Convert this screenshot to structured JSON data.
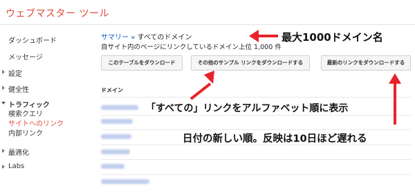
{
  "header": {
    "title": "ウェブマスター ツール"
  },
  "sidebar": {
    "items": [
      {
        "label": "ダッシュボード"
      },
      {
        "label": "メッセージ"
      },
      {
        "label": "設定"
      },
      {
        "label": "健全性"
      },
      {
        "label": "トラフィック"
      },
      {
        "label": "検索クエリ"
      },
      {
        "label": "サイトへのリンク"
      },
      {
        "label": "内部リンク"
      },
      {
        "label": "最適化"
      },
      {
        "label": "Labs"
      }
    ]
  },
  "main": {
    "breadcrumb": {
      "summary": "サマリー",
      "sep": "»",
      "current": "すべてのドメイン"
    },
    "subtitle": "自サイト内のページにリンクしているドメイン上位 1,000 件",
    "buttons": {
      "download_table": "このテーブルをダウンロード",
      "download_sample": "その他のサンプル リンクをダウンロードする",
      "download_latest": "最新のリンクをダウンロードする"
    },
    "table": {
      "header": "ドメイン"
    }
  },
  "annotations": {
    "max_domains": "最大1000ドメイン名",
    "alphabetical": "「すべての」リンクをアルファベット順に表示",
    "newest_first": "日付の新しい順。反映は10日ほど遅れる"
  },
  "colors": {
    "brand": "#dd4b39",
    "link": "#1155cc",
    "arrow": "#e8222a"
  }
}
